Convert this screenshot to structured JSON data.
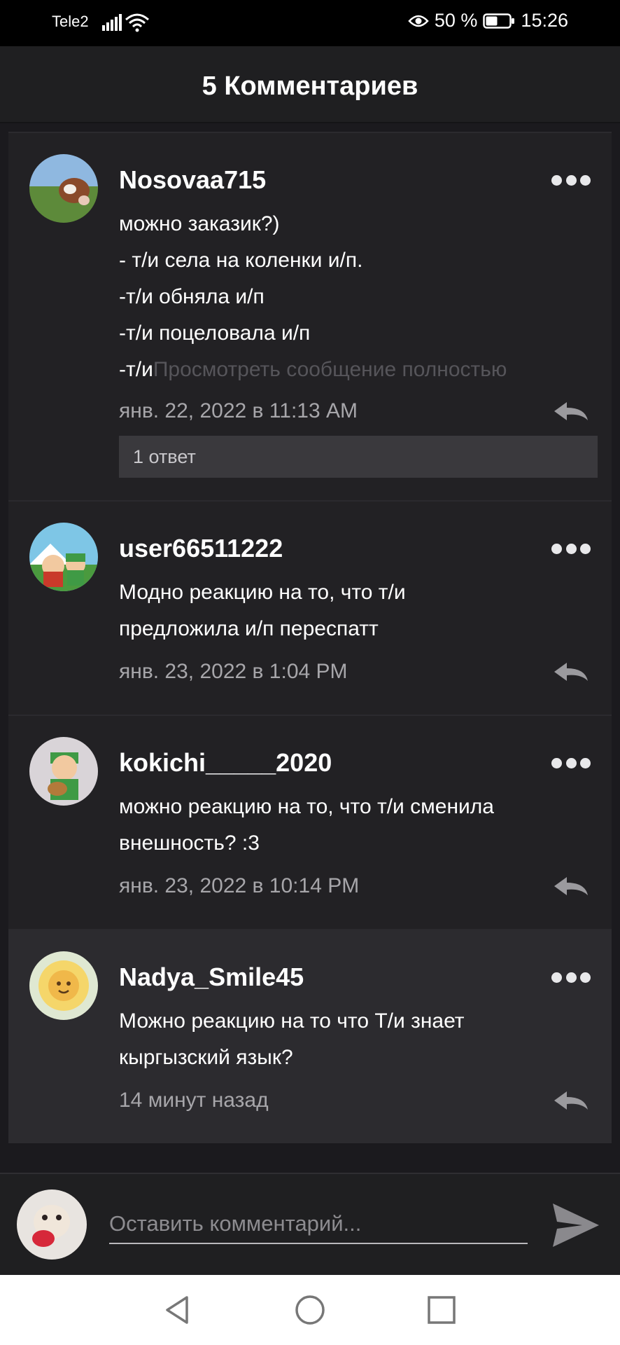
{
  "status_bar": {
    "carrier": "Tele2",
    "battery_text": "50 %",
    "time": "15:26",
    "icons": [
      "signal-icon",
      "wifi-icon",
      "eye-icon",
      "battery-icon"
    ]
  },
  "header": {
    "title": "5 Комментариев"
  },
  "comments": [
    {
      "username": "Nosovaa715",
      "lines": [
        "можно заказик?)",
        "- т/и села на коленки и/п.",
        "-т/и обняла и/п",
        "-т/и поцеловала и/п"
      ],
      "last_line_prefix": "-т/и",
      "view_full_link": "Просмотреть сообщение полностью",
      "timestamp": "янв. 22, 2022 в 11:13 AM",
      "replies_label": "1 ответ"
    },
    {
      "username": "user66511222",
      "lines": [
        "Модно реакцию на то, что т/и",
        "предложила и/п переспатт"
      ],
      "timestamp": "янв. 23, 2022 в 1:04 PM"
    },
    {
      "username": "kokichi_____2020",
      "lines": [
        "можно реакцию на то, что т/и сменила",
        "внешность? :3"
      ],
      "timestamp": "янв. 23, 2022 в 10:14 PM"
    },
    {
      "username": "Nadya_Smile45",
      "lines": [
        "Можно реакцию на то что Т/и знает",
        "кыргызский язык?"
      ],
      "timestamp": "14 минут назад"
    }
  ],
  "input": {
    "placeholder": "Оставить комментарий..."
  },
  "colors": {
    "background": "#1b1a1e",
    "card": "#222124",
    "highlight": "#2c2b2f",
    "meta_text": "#a7a6aa"
  }
}
